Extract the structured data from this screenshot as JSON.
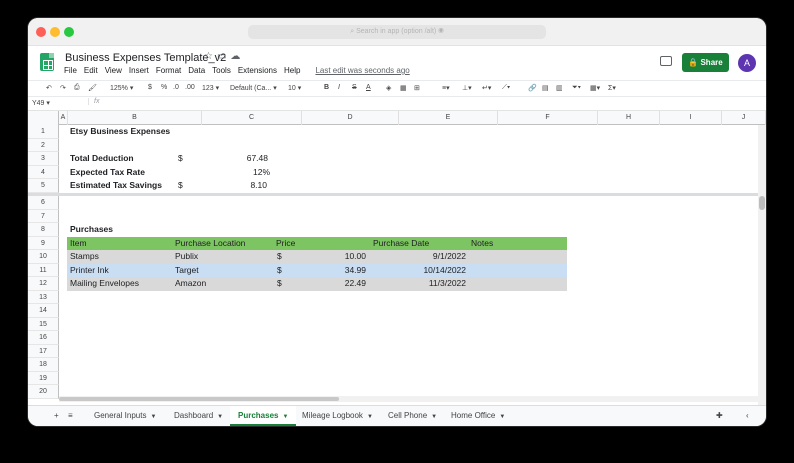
{
  "window": {
    "url_text": "⌕  Search in app (option /alt)  ◉"
  },
  "app": {
    "doc_title": "Business Expenses Template_v2",
    "menu": [
      "File",
      "Edit",
      "View",
      "Insert",
      "Format",
      "Data",
      "Tools",
      "Extensions",
      "Help"
    ],
    "last_edit": "Last edit was seconds ago",
    "share_label": "Share",
    "avatar_letter": "A"
  },
  "toolbar": {
    "zoom": "125%",
    "currency": "$",
    "percent": "%",
    "dec_dec": ".0",
    "dec_inc": ".00",
    "more_formats": "123",
    "font": "Default (Ca...",
    "font_size": "10"
  },
  "formula_bar": {
    "name_box": "Y49",
    "fx": "fx"
  },
  "columns": [
    "A",
    "B",
    "C",
    "D",
    "E",
    "F",
    "H",
    "I",
    "J"
  ],
  "rows": [
    "1",
    "2",
    "3",
    "4",
    "5",
    "6",
    "7",
    "8",
    "9",
    "10",
    "11",
    "12",
    "13",
    "14",
    "15",
    "16",
    "17",
    "18",
    "19",
    "20"
  ],
  "summary": {
    "title": "Etsy Business Expenses",
    "total_deduction_label": "Total Deduction",
    "total_deduction_currency": "$",
    "total_deduction_value": "67.48",
    "tax_rate_label": "Expected Tax Rate",
    "tax_rate_value": "12%",
    "tax_savings_label": "Estimated Tax Savings",
    "tax_savings_currency": "$",
    "tax_savings_value": "8.10"
  },
  "purchases": {
    "title": "Purchases",
    "headers": [
      "Item",
      "Purchase Location",
      "Price",
      "Purchase Date",
      "Notes"
    ],
    "rows": [
      {
        "item": "Stamps",
        "location": "Publix",
        "currency": "$",
        "price": "10.00",
        "date": "9/1/2022"
      },
      {
        "item": "Printer Ink",
        "location": "Target",
        "currency": "$",
        "price": "34.99",
        "date": "10/14/2022"
      },
      {
        "item": "Mailing Envelopes",
        "location": "Amazon",
        "currency": "$",
        "price": "22.49",
        "date": "11/3/2022"
      }
    ]
  },
  "tabs": [
    "General Inputs",
    "Dashboard",
    "Purchases",
    "Mileage Logbook",
    "Cell Phone",
    "Home Office"
  ],
  "colors": {
    "header_green": "#7dc462",
    "row_gray": "#d9d9d9",
    "row_blue": "#c9ddf3",
    "share_green": "#188038"
  }
}
